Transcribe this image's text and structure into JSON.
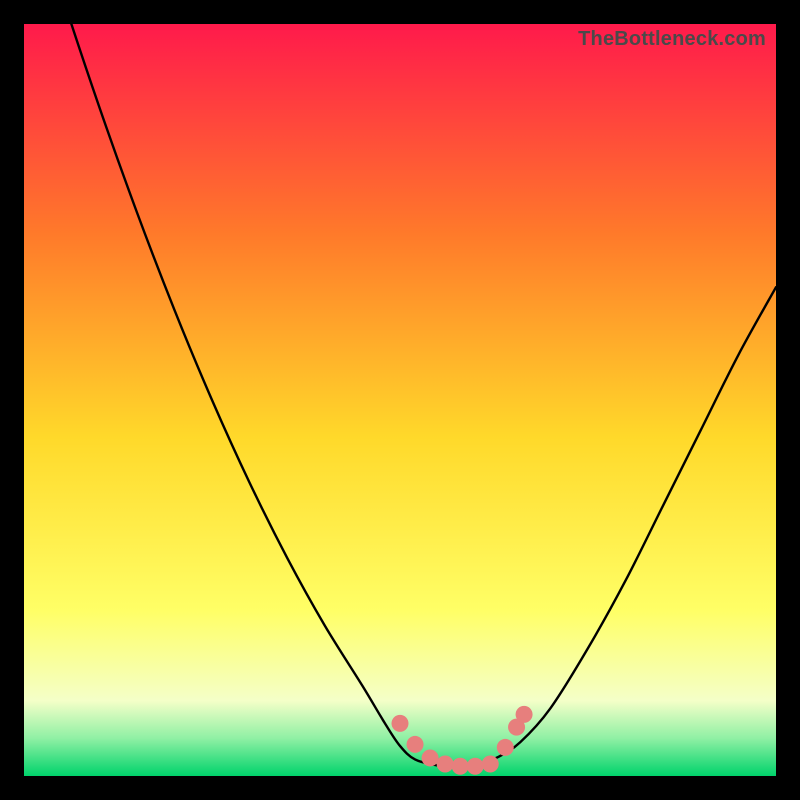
{
  "watermark": "TheBottleneck.com",
  "colors": {
    "frame": "#000000",
    "grad_top": "#ff1a4b",
    "grad_mid1": "#ff7a2a",
    "grad_mid2": "#ffd92a",
    "grad_mid3": "#ffff66",
    "grad_low1": "#f4ffc8",
    "grad_low2": "#8ff0a4",
    "grad_bottom": "#00d36b",
    "curve": "#000000",
    "marker_fill": "#e77f7d",
    "marker_stroke": "#c4605e"
  },
  "chart_data": {
    "type": "line",
    "title": "",
    "xlabel": "",
    "ylabel": "",
    "xlim": [
      0,
      100
    ],
    "ylim": [
      0,
      100
    ],
    "series": [
      {
        "name": "bottleneck-curve",
        "x": [
          0,
          5,
          10,
          15,
          20,
          25,
          30,
          35,
          40,
          45,
          48,
          50,
          52,
          55,
          58,
          60,
          63,
          66,
          70,
          75,
          80,
          85,
          90,
          95,
          100
        ],
        "y": [
          120,
          104,
          89,
          75,
          62,
          50,
          39,
          29,
          20,
          12,
          7,
          4,
          2.2,
          1.4,
          1.2,
          1.4,
          2.5,
          4.5,
          9,
          17,
          26,
          36,
          46,
          56,
          65
        ]
      }
    ],
    "markers": [
      {
        "x": 50,
        "y": 7.0
      },
      {
        "x": 52,
        "y": 4.2
      },
      {
        "x": 54,
        "y": 2.4
      },
      {
        "x": 56,
        "y": 1.6
      },
      {
        "x": 58,
        "y": 1.3
      },
      {
        "x": 60,
        "y": 1.3
      },
      {
        "x": 62,
        "y": 1.6
      },
      {
        "x": 64,
        "y": 3.8
      },
      {
        "x": 65.5,
        "y": 6.5
      },
      {
        "x": 66.5,
        "y": 8.2
      }
    ]
  }
}
